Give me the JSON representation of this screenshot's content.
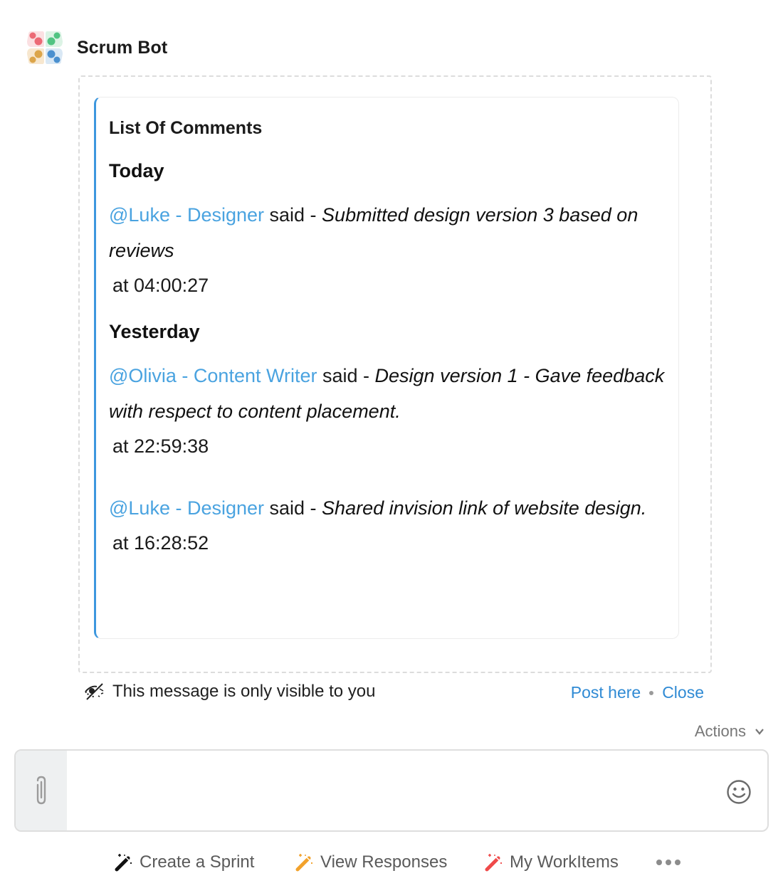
{
  "bot": {
    "name": "Scrum Bot",
    "avatar_icon": "scrum-bot-logo-icon"
  },
  "card": {
    "title": "List Of Comments",
    "accent_color": "#3d97de",
    "sections": [
      {
        "heading": "Today",
        "comments": [
          {
            "mention": "@Luke - Designer",
            "said": " said - ",
            "message": "Submitted design version 3 based on reviews",
            "time": "at 04:00:27"
          }
        ]
      },
      {
        "heading": "Yesterday",
        "comments": [
          {
            "mention": "@Olivia - Content Writer",
            "said": " said - ",
            "message": "Design version 1 - Gave feedback with respect to content placement.",
            "time": "at 22:59:38"
          },
          {
            "mention": "@Luke - Designer",
            "said": " said - ",
            "message": "Shared invision link of website design.",
            "time": "at 16:28:52"
          }
        ]
      }
    ]
  },
  "ephemeral": {
    "icon": "eye-slash-icon",
    "notice": "This message is only visible to you",
    "post_here": "Post here",
    "close": "Close"
  },
  "actions_menu": {
    "label": "Actions",
    "icon": "chevron-down-icon"
  },
  "composer": {
    "value": "",
    "placeholder": "",
    "attach_icon": "paperclip-icon",
    "emoji_icon": "smiley-icon"
  },
  "quick_actions": [
    {
      "label": "Create a Sprint",
      "icon": "magic-wand-icon",
      "color": "#111111"
    },
    {
      "label": "View Responses",
      "icon": "magic-wand-icon",
      "color": "#f2a22c"
    },
    {
      "label": "My WorkItems",
      "icon": "magic-wand-icon",
      "color": "#ef4a4a"
    }
  ],
  "more_icon": "more-dots-icon",
  "colors": {
    "mention": "#4aa3e0",
    "link": "#2f8ad4"
  }
}
